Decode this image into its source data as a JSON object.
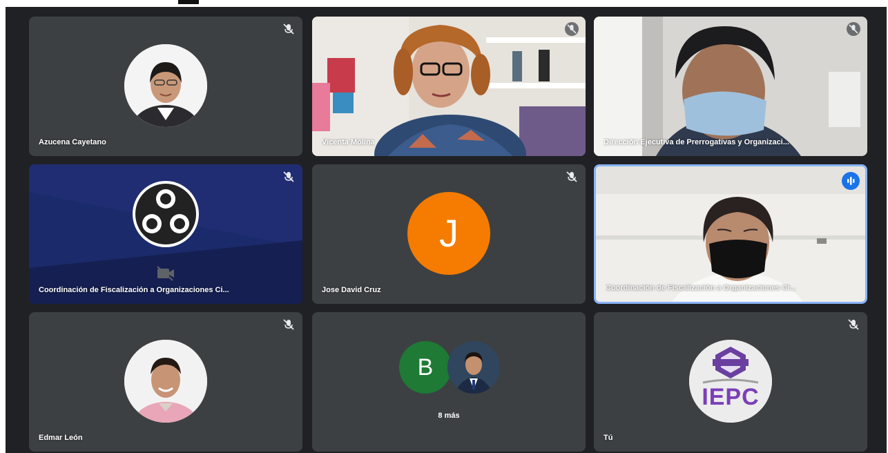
{
  "participants": [
    {
      "name": "Azucena Cayetano",
      "type": "photo-avatar"
    },
    {
      "name": "Vicenta Molina",
      "type": "video"
    },
    {
      "name": "Dirección Ejecutiva de Prerrogativas y Organizaci...",
      "type": "video"
    },
    {
      "name": "Coordinación de Fiscalización a Organizaciones Ci...",
      "type": "video-off"
    },
    {
      "name": "Jose David Cruz",
      "type": "letter-avatar",
      "initial": "J"
    },
    {
      "name": "Coordinación de Fiscalización a Organizaciones Ci...",
      "type": "video",
      "speaking": true
    },
    {
      "name": "Edmar León",
      "type": "photo-avatar"
    },
    {
      "name": "",
      "type": "overflow",
      "initial": "B",
      "label": "8 más"
    },
    {
      "name": "Tú",
      "type": "logo-avatar",
      "logo_text": "IEPC"
    }
  ],
  "colors": {
    "stage": "#202124",
    "tile": "#3c4043",
    "active_border": "#8ab4f8",
    "speaking_badge": "#1a73e8",
    "avatar_orange": "#f57c00",
    "avatar_green": "#1e7a34"
  },
  "icons": [
    "mic-off-icon",
    "speaking-indicator-icon",
    "video-off-icon",
    "obs-logo-icon"
  ]
}
